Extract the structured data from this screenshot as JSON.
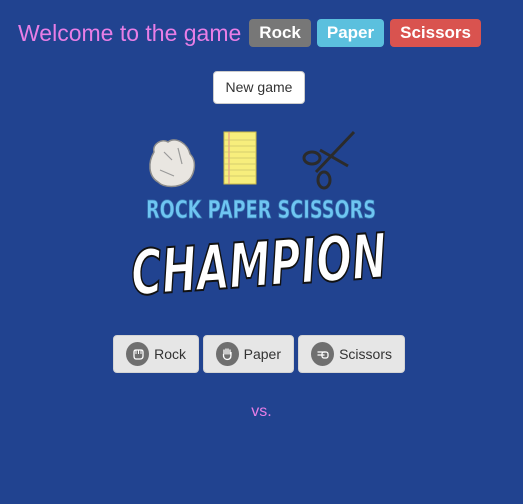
{
  "header": {
    "welcome": "Welcome to the game",
    "badges": [
      {
        "label": "Rock",
        "color": "#777777"
      },
      {
        "label": "Paper",
        "color": "#5bc0de"
      },
      {
        "label": "Scissors",
        "color": "#d9534f"
      }
    ]
  },
  "new_game_label": "New game",
  "logo": {
    "top_text": "ROCK PAPER SCISSORS",
    "main_text": "CHAMPION"
  },
  "choices": [
    {
      "label": "Rock",
      "icon": "hand-rock-icon"
    },
    {
      "label": "Paper",
      "icon": "hand-paper-icon"
    },
    {
      "label": "Scissors",
      "icon": "hand-scissors-icon"
    }
  ],
  "vs_text": "vs.",
  "colors": {
    "background": "#214390",
    "accent_text": "#e87ee6",
    "logo_blue": "#6fc6f2"
  }
}
